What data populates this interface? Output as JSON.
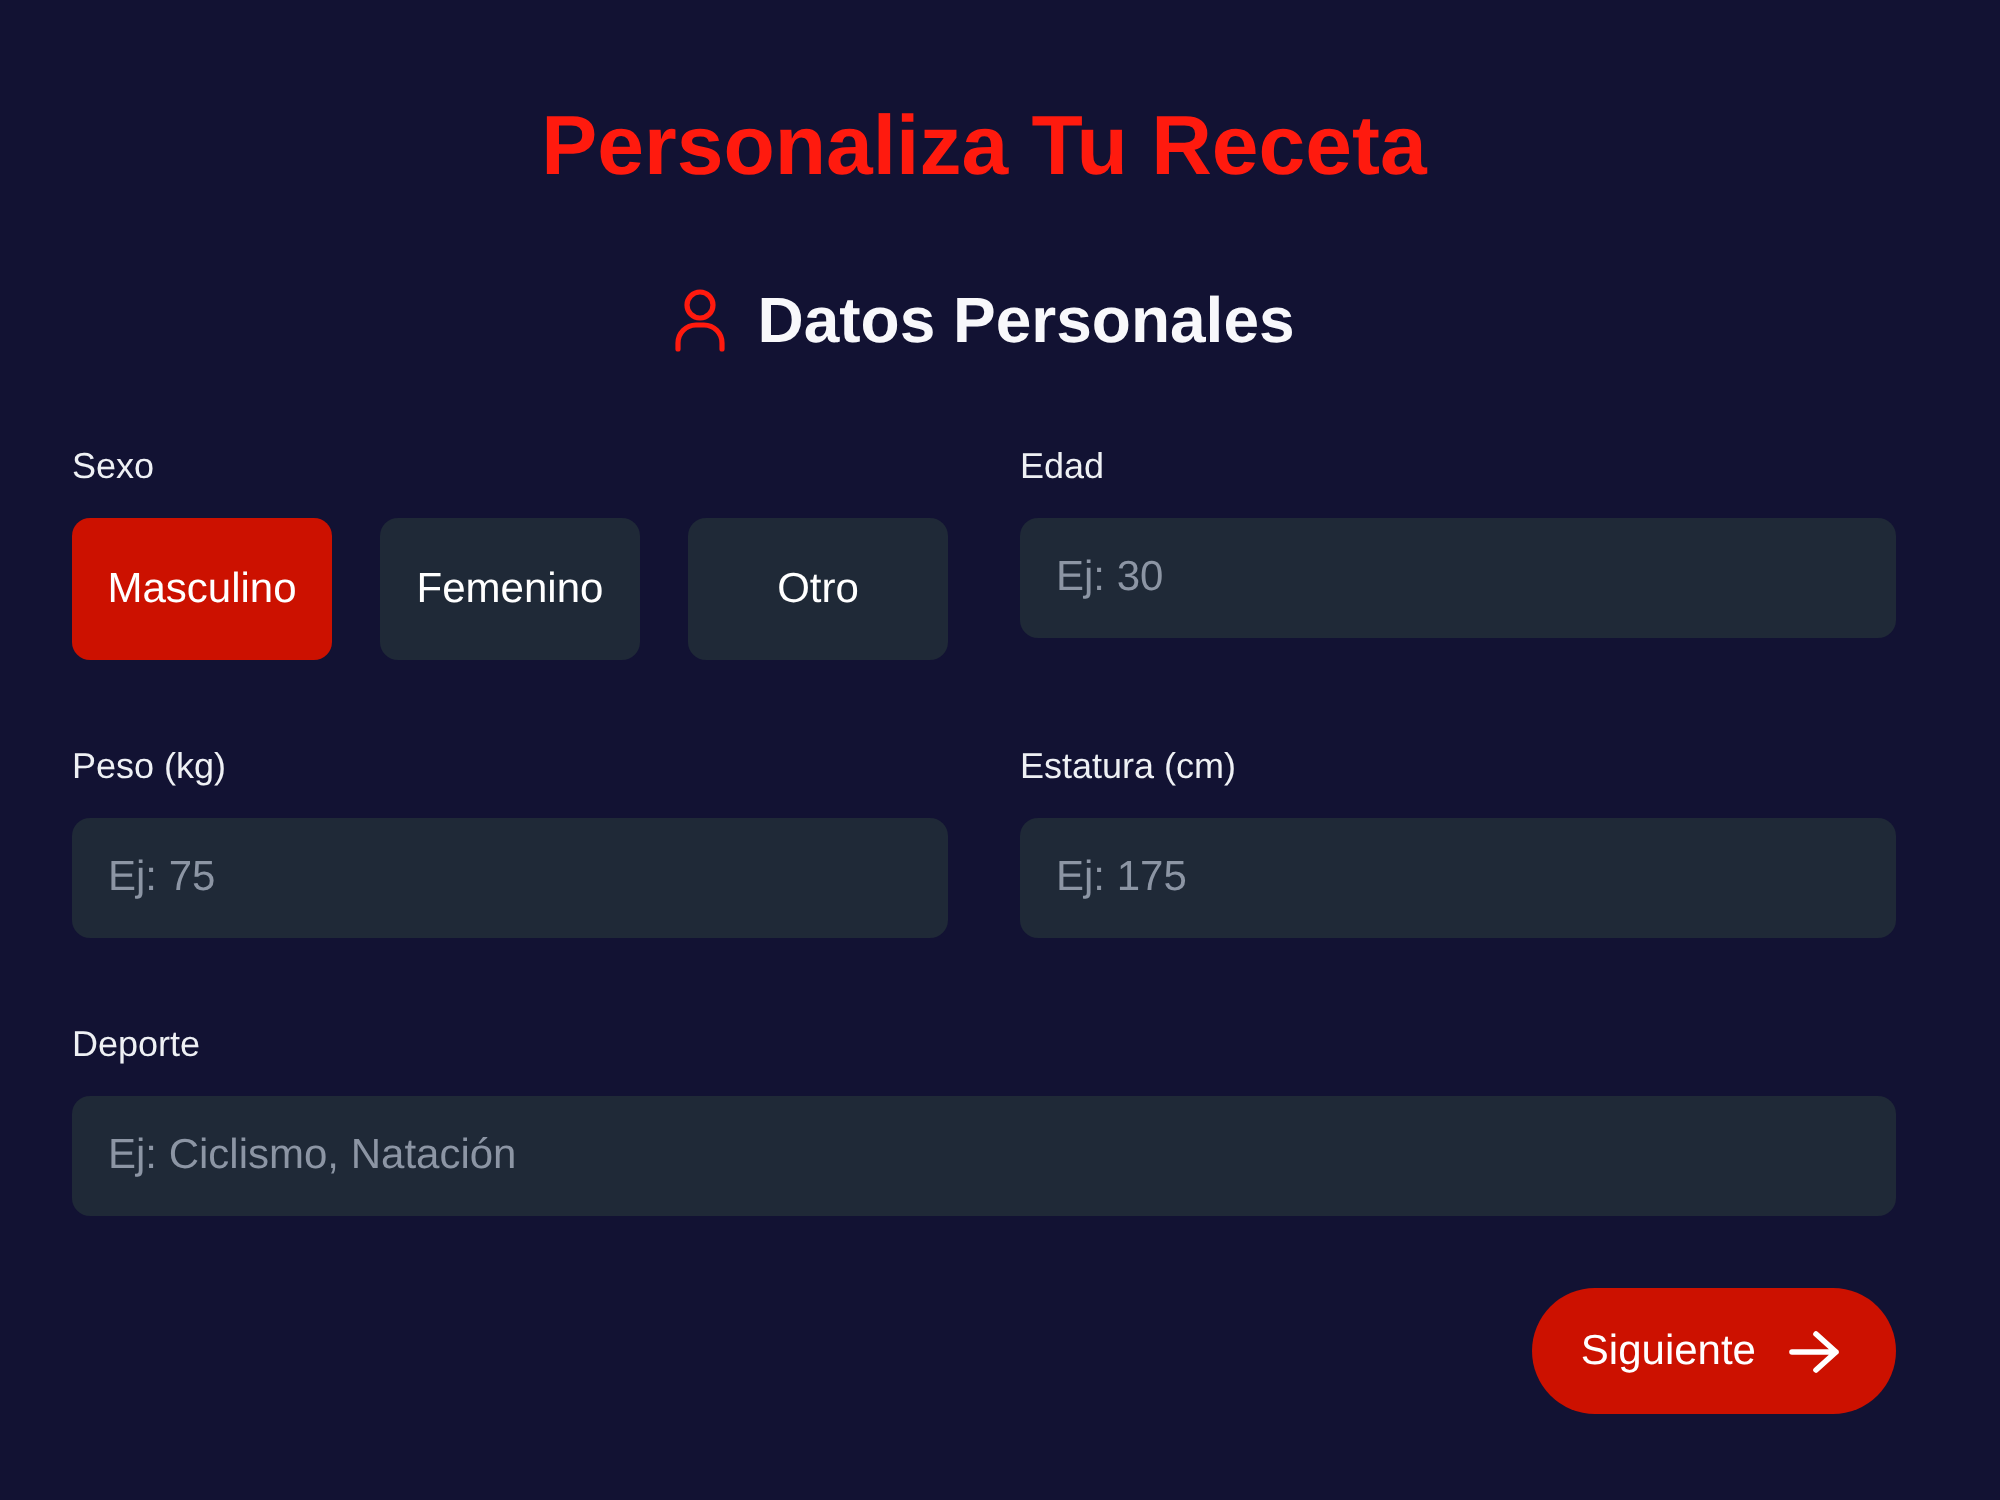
{
  "title": "Personaliza Tu Receta",
  "section": {
    "title": "Datos Personales"
  },
  "rows": [
    [
      {
        "kind": "choice",
        "label": "Sexo",
        "options": [
          {
            "label": "Masculino",
            "selected": true
          },
          {
            "label": "Femenino",
            "selected": false
          },
          {
            "label": "Otro",
            "selected": false
          }
        ]
      },
      {
        "kind": "input",
        "label": "Edad",
        "placeholder": "Ej: 30"
      }
    ],
    [
      {
        "kind": "input",
        "label": "Peso (kg)",
        "placeholder": "Ej: 75"
      },
      {
        "kind": "input",
        "label": "Estatura (cm)",
        "placeholder": "Ej: 175"
      }
    ],
    [
      {
        "kind": "input",
        "label": "Deporte",
        "placeholder": "Ej: Ciclismo, Natación"
      }
    ]
  ],
  "next_button": {
    "label": "Siguiente"
  }
}
